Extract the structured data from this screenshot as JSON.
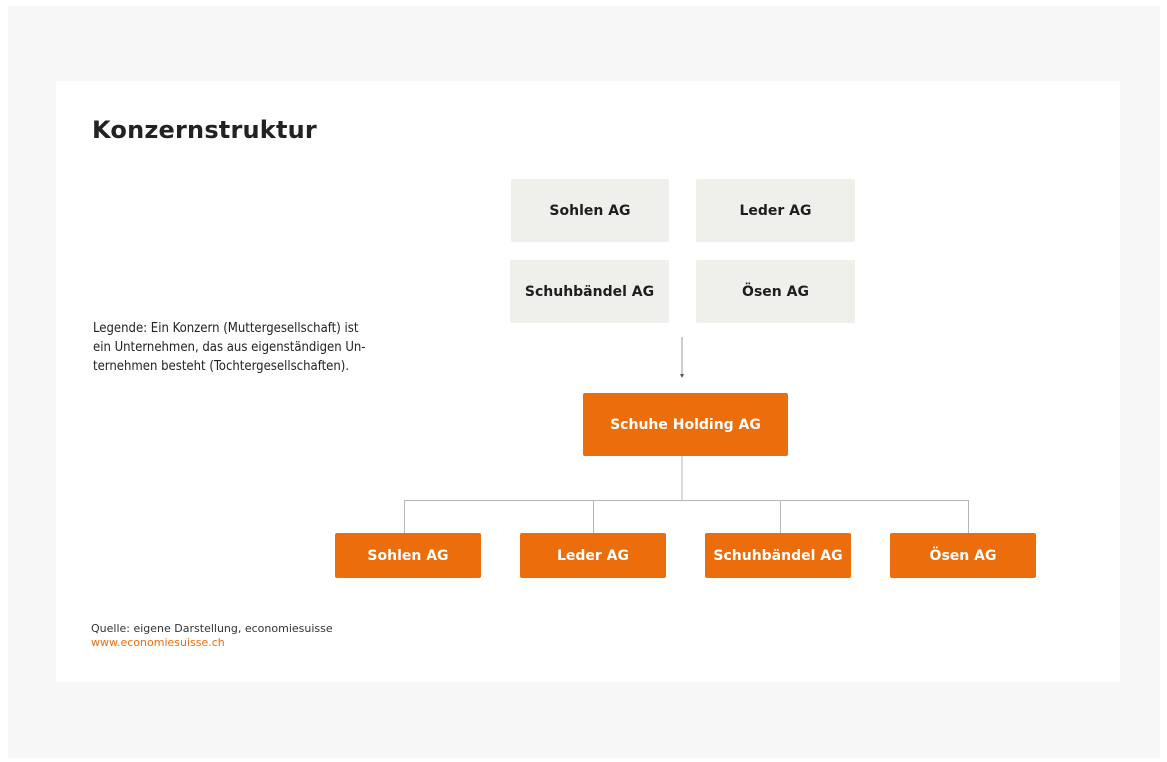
{
  "title": "Konzernstruktur",
  "legend": {
    "lines": [
      "Legende: Ein Konzern (Muttergesellschaft) ist",
      "ein Unternehmen, das aus eigenständigen Un-",
      "ternehmen besteht (Tochtergesellschaften)."
    ]
  },
  "acquired_companies": [
    {
      "label": "Sohlen AG"
    },
    {
      "label": "Leder AG"
    },
    {
      "label": "Schuhbändel AG"
    },
    {
      "label": "Ösen AG"
    }
  ],
  "holding": {
    "label": "Schuhe Holding AG"
  },
  "subsidiaries": [
    {
      "label": "Sohlen AG"
    },
    {
      "label": "Leder AG"
    },
    {
      "label": "Schuhbändel AG"
    },
    {
      "label": "Ösen AG"
    }
  ],
  "source": {
    "text": "Quelle: eigene Darstellung, economiesuisse",
    "link": "www.economiesuisse.ch"
  },
  "colors": {
    "accent": "#ec6d0b",
    "grey_box": "#efefec",
    "connector": "#b5b5b5"
  }
}
